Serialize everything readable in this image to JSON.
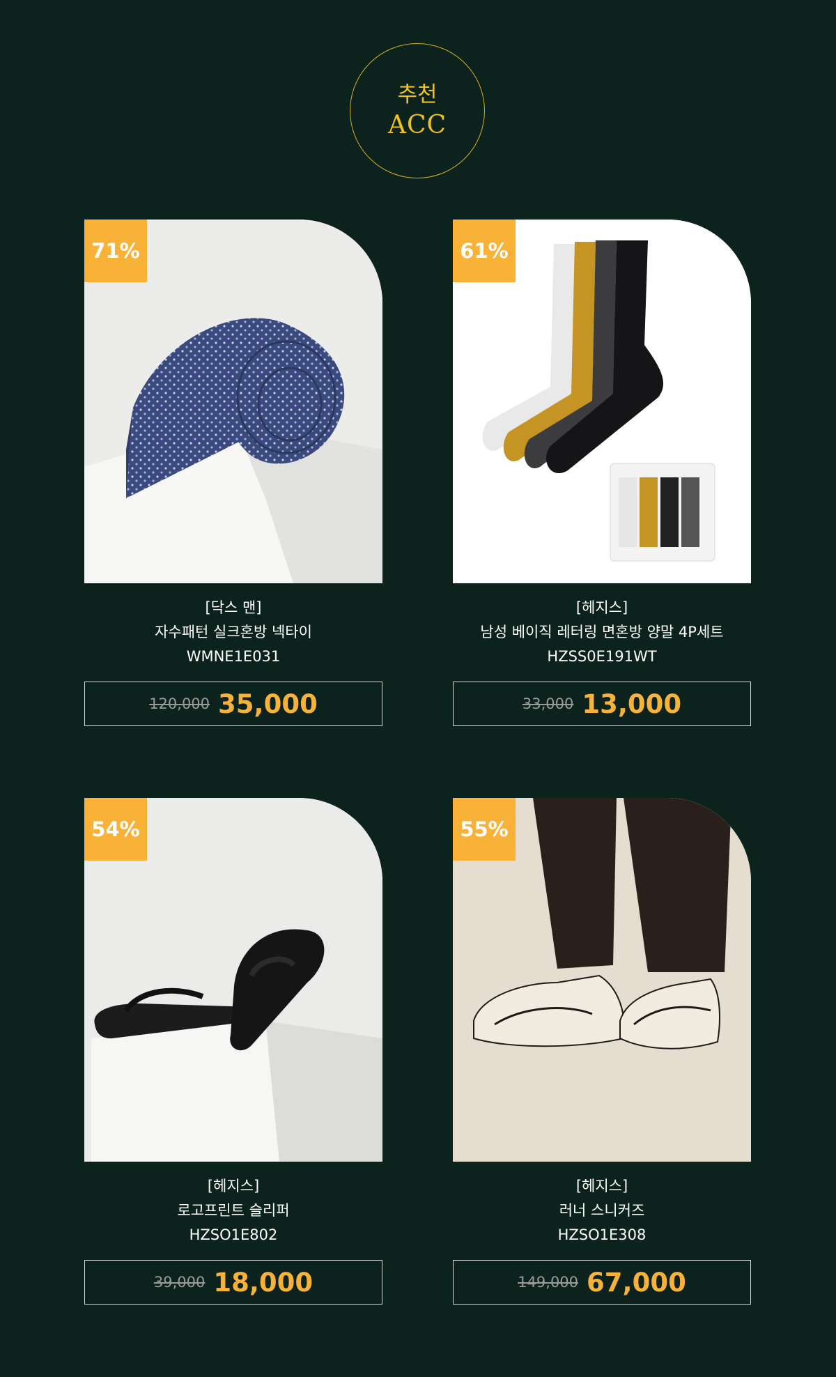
{
  "header": {
    "label_kr": "추천",
    "label_en": "ACC"
  },
  "colors": {
    "background": "#0c231d",
    "accent": "#f9b238",
    "gold": "#f0c21c"
  },
  "products": [
    {
      "discount": "71%",
      "brand": "[닥스 맨]",
      "name": "자수패턴 실크혼방 넥타이",
      "code": "WMNE1E031",
      "original_price": "120,000",
      "sale_price": "35,000",
      "image_icon": "necktie-image"
    },
    {
      "discount": "61%",
      "brand": "[헤지스]",
      "name": "남성 베이직 레터링 면혼방 양말 4P세트",
      "code": "HZSS0E191WT",
      "original_price": "33,000",
      "sale_price": "13,000",
      "image_icon": "socks-image"
    },
    {
      "discount": "54%",
      "brand": "[헤지스]",
      "name": "로고프린트 슬리퍼",
      "code": "HZSO1E802",
      "original_price": "39,000",
      "sale_price": "18,000",
      "image_icon": "slippers-image"
    },
    {
      "discount": "55%",
      "brand": "[헤지스]",
      "name": "러너 스니커즈",
      "code": "HZSO1E308",
      "original_price": "149,000",
      "sale_price": "67,000",
      "image_icon": "sneakers-image"
    }
  ]
}
